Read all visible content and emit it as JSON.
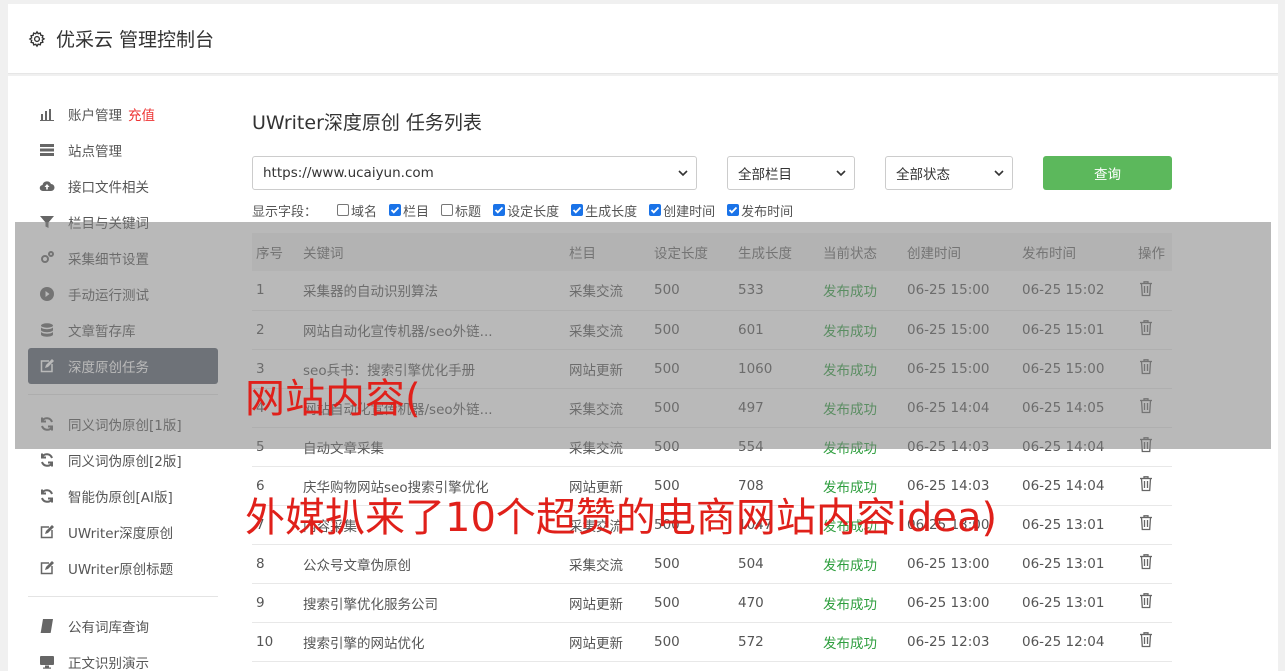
{
  "header": {
    "title": "优采云 管理控制台"
  },
  "sidebar": {
    "items": [
      {
        "label": "账户管理",
        "accent": "充值",
        "icon": "bar-chart-icon"
      },
      {
        "label": "站点管理",
        "icon": "server-icon"
      },
      {
        "label": "接口文件相关",
        "icon": "cloud-upload-icon"
      },
      {
        "label": "栏目与关键词",
        "icon": "filter-icon"
      },
      {
        "label": "采集细节设置",
        "icon": "cogs-icon"
      },
      {
        "label": "手动运行测试",
        "icon": "play-circle-icon"
      },
      {
        "label": "文章暂存库",
        "icon": "database-icon"
      },
      {
        "label": "深度原创任务",
        "icon": "edit-icon",
        "active": true
      }
    ],
    "items2": [
      {
        "label": "同义词伪原创[1版]",
        "icon": "refresh-icon"
      },
      {
        "label": "同义词伪原创[2版]",
        "icon": "refresh-icon"
      },
      {
        "label": "智能伪原创[AI版]",
        "icon": "refresh-icon"
      },
      {
        "label": "UWriter深度原创",
        "icon": "edit-icon"
      },
      {
        "label": "UWriter原创标题",
        "icon": "edit-icon"
      }
    ],
    "items3": [
      {
        "label": "公有词库查询",
        "icon": "book-icon"
      },
      {
        "label": "正文识别演示",
        "icon": "monitor-icon"
      }
    ]
  },
  "main": {
    "title": "UWriter深度原创 任务列表",
    "filters": {
      "site": "https://www.ucaiyun.com",
      "column": "全部栏目",
      "status": "全部状态",
      "query_label": "查询"
    },
    "fields_label": "显示字段：",
    "fields": [
      {
        "label": "域名",
        "checked": false
      },
      {
        "label": "栏目",
        "checked": true
      },
      {
        "label": "标题",
        "checked": false
      },
      {
        "label": "设定长度",
        "checked": true
      },
      {
        "label": "生成长度",
        "checked": true
      },
      {
        "label": "创建时间",
        "checked": true
      },
      {
        "label": "发布时间",
        "checked": true
      }
    ],
    "table": {
      "columns": [
        "序号",
        "关键词",
        "栏目",
        "设定长度",
        "生成长度",
        "当前状态",
        "创建时间",
        "发布时间",
        "操作"
      ],
      "rows": [
        [
          "1",
          "采集器的自动识别算法",
          "采集交流",
          "500",
          "533",
          "发布成功",
          "06-25 15:00",
          "06-25 15:02"
        ],
        [
          "2",
          "网站自动化宣传机器/seo外链...",
          "采集交流",
          "500",
          "601",
          "发布成功",
          "06-25 15:00",
          "06-25 15:01"
        ],
        [
          "3",
          "seo兵书：搜索引擎优化手册",
          "网站更新",
          "500",
          "1060",
          "发布成功",
          "06-25 15:00",
          "06-25 15:00"
        ],
        [
          "4",
          "网站自动化宣传机器/seo外链...",
          "采集交流",
          "500",
          "497",
          "发布成功",
          "06-25 14:04",
          "06-25 14:05"
        ],
        [
          "5",
          "自动文章采集",
          "采集交流",
          "500",
          "554",
          "发布成功",
          "06-25 14:03",
          "06-25 14:04"
        ],
        [
          "6",
          "庆华购物网站seo搜索引擎优化",
          "网站更新",
          "500",
          "708",
          "发布成功",
          "06-25 14:03",
          "06-25 14:04"
        ],
        [
          "7",
          "内容采集",
          "采集交流",
          "500",
          "1047",
          "发布成功",
          "06-25 13:00",
          "06-25 13:01"
        ],
        [
          "8",
          "公众号文章伪原创",
          "采集交流",
          "500",
          "504",
          "发布成功",
          "06-25 13:00",
          "06-25 13:01"
        ],
        [
          "9",
          "搜索引擎优化服务公司",
          "网站更新",
          "500",
          "470",
          "发布成功",
          "06-25 13:00",
          "06-25 13:01"
        ],
        [
          "10",
          "搜索引擎的网站优化",
          "网站更新",
          "500",
          "572",
          "发布成功",
          "06-25 12:03",
          "06-25 12:04"
        ]
      ]
    }
  },
  "overlay": {
    "line1": "网站内容(",
    "line2": "外媒扒来了10个超赞的电商网站内容idea)"
  },
  "colors": {
    "accent_green": "#5cb85c",
    "status_ok": "#2e9e3e",
    "active_nav": "#5a6270",
    "overlay_text": "#e0201a"
  }
}
